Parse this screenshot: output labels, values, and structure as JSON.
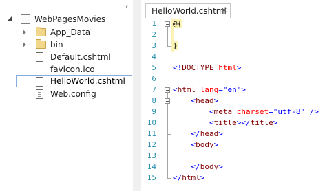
{
  "explorer": {
    "collapse_glyph": "‹",
    "items": [
      {
        "label": "WebPagesMovies",
        "icon": "website-icon",
        "expander": "expanded",
        "indent": 0
      },
      {
        "label": "App_Data",
        "icon": "folder-icon",
        "expander": "collapsed",
        "indent": 1
      },
      {
        "label": "bin",
        "icon": "folder-icon",
        "expander": "collapsed",
        "indent": 1
      },
      {
        "label": "Default.cshtml",
        "icon": "file-icon",
        "expander": "none",
        "indent": 1
      },
      {
        "label": "favicon.ico",
        "icon": "file-icon",
        "expander": "none",
        "indent": 1
      },
      {
        "label": "HelloWorld.cshtml",
        "icon": "file-icon",
        "expander": "none",
        "indent": 1,
        "selected": true
      },
      {
        "label": "Web.config",
        "icon": "config-file-icon",
        "expander": "none",
        "indent": 1
      }
    ]
  },
  "editor": {
    "tab": {
      "title": "HelloWorld.cshtml",
      "close": "×"
    },
    "line_numbers": [
      "1",
      "2",
      "3",
      "4",
      "5",
      "6",
      "7",
      "8",
      "9",
      "10",
      "11",
      "12",
      "13",
      "14",
      "15"
    ],
    "lines": [
      [
        {
          "t": "@{",
          "c": "razor"
        }
      ],
      [],
      [
        {
          "t": "}",
          "c": "razor"
        }
      ],
      [],
      [
        {
          "t": "<!",
          "c": "punct"
        },
        {
          "t": "DOCTYPE",
          "c": "tag"
        },
        {
          "t": " ",
          "c": "plain"
        },
        {
          "t": "html",
          "c": "attr"
        },
        {
          "t": ">",
          "c": "punct"
        }
      ],
      [],
      [
        {
          "t": "<",
          "c": "punct"
        },
        {
          "t": "html",
          "c": "tag"
        },
        {
          "t": " ",
          "c": "plain"
        },
        {
          "t": "lang",
          "c": "attr"
        },
        {
          "t": "=",
          "c": "punct"
        },
        {
          "t": "\"en\"",
          "c": "val"
        },
        {
          "t": ">",
          "c": "punct"
        }
      ],
      [
        {
          "t": "    ",
          "c": "plain"
        },
        {
          "t": "<",
          "c": "punct"
        },
        {
          "t": "head",
          "c": "tag"
        },
        {
          "t": ">",
          "c": "punct"
        }
      ],
      [
        {
          "t": "        ",
          "c": "plain"
        },
        {
          "t": "<",
          "c": "punct"
        },
        {
          "t": "meta",
          "c": "tag"
        },
        {
          "t": " ",
          "c": "plain"
        },
        {
          "t": "charset",
          "c": "attr"
        },
        {
          "t": "=",
          "c": "punct"
        },
        {
          "t": "\"utf-8\"",
          "c": "val"
        },
        {
          "t": " />",
          "c": "punct"
        }
      ],
      [
        {
          "t": "        ",
          "c": "plain"
        },
        {
          "t": "<",
          "c": "punct"
        },
        {
          "t": "title",
          "c": "tag"
        },
        {
          "t": "></",
          "c": "punct"
        },
        {
          "t": "title",
          "c": "tag"
        },
        {
          "t": ">",
          "c": "punct"
        }
      ],
      [
        {
          "t": "    ",
          "c": "plain"
        },
        {
          "t": "</",
          "c": "punct"
        },
        {
          "t": "head",
          "c": "tag"
        },
        {
          "t": ">",
          "c": "punct"
        }
      ],
      [
        {
          "t": "    ",
          "c": "plain"
        },
        {
          "t": "<",
          "c": "punct"
        },
        {
          "t": "body",
          "c": "tag"
        },
        {
          "t": ">",
          "c": "punct"
        }
      ],
      [],
      [
        {
          "t": "    ",
          "c": "plain"
        },
        {
          "t": "</",
          "c": "punct"
        },
        {
          "t": "body",
          "c": "tag"
        },
        {
          "t": ">",
          "c": "punct"
        }
      ],
      [
        {
          "t": "</",
          "c": "punct"
        },
        {
          "t": "html",
          "c": "tag"
        },
        {
          "t": ">",
          "c": "punct"
        }
      ]
    ]
  }
}
